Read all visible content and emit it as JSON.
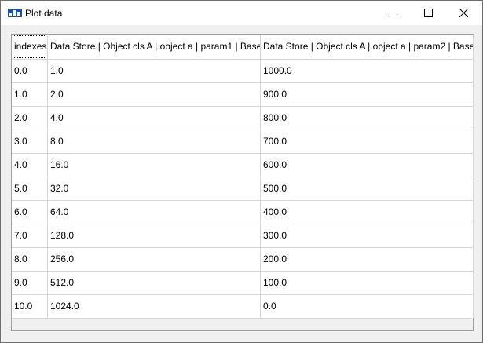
{
  "window": {
    "title": "Plot data",
    "icon": "plot-app-icon"
  },
  "controls": {
    "minimize": "minimize-icon",
    "maximize": "maximize-icon",
    "close": "close-icon"
  },
  "table": {
    "columns": [
      "indexes",
      "Data Store | Object cls A | object a | param1 | Base",
      "Data Store | Object cls A | object a | param2 | Base"
    ],
    "rows": [
      [
        "0.0",
        "1.0",
        "1000.0"
      ],
      [
        "1.0",
        "2.0",
        "900.0"
      ],
      [
        "2.0",
        "4.0",
        "800.0"
      ],
      [
        "3.0",
        "8.0",
        "700.0"
      ],
      [
        "4.0",
        "16.0",
        "600.0"
      ],
      [
        "5.0",
        "32.0",
        "500.0"
      ],
      [
        "6.0",
        "64.0",
        "400.0"
      ],
      [
        "7.0",
        "128.0",
        "300.0"
      ],
      [
        "8.0",
        "256.0",
        "200.0"
      ],
      [
        "9.0",
        "512.0",
        "100.0"
      ],
      [
        "10.0",
        "1024.0",
        "0.0"
      ]
    ]
  }
}
